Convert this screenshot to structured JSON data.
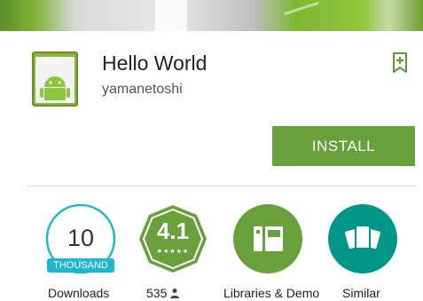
{
  "app": {
    "title": "Hello World",
    "developer": "yamanetoshi",
    "icon_text": "Android"
  },
  "actions": {
    "install_label": "INSTALL"
  },
  "badges": {
    "downloads": {
      "number": "10",
      "unit": "THOUSAND",
      "label": "Downloads"
    },
    "rating": {
      "value": "4.1",
      "stars": "★★★★★",
      "count": "535"
    },
    "category": {
      "label": "Libraries & Demo"
    },
    "similar": {
      "label": "Similar"
    }
  },
  "colors": {
    "accent_green": "#68a13b",
    "downloads_blue": "#1fb6cf",
    "rating_green": "#68a13b",
    "similar_teal": "#009688"
  },
  "icons": {
    "wishlist": "bookmark-plus-icon",
    "reviewer": "person-icon",
    "category": "library-book-icon",
    "similar": "cards-icon"
  }
}
